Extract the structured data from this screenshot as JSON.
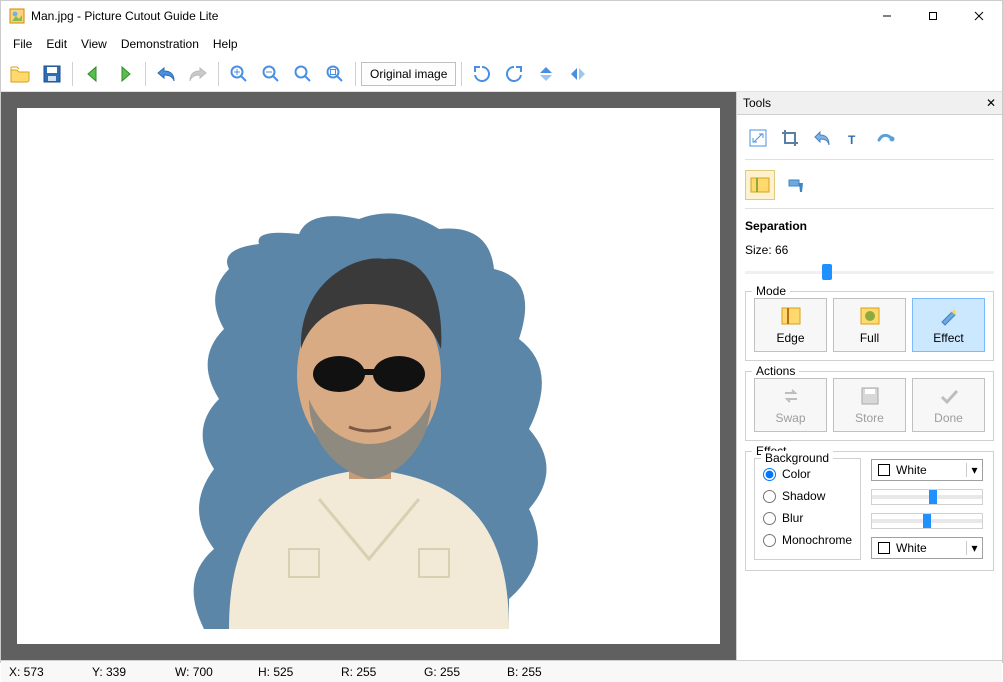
{
  "window": {
    "title": "Man.jpg - Picture Cutout Guide Lite"
  },
  "menu": {
    "file": "File",
    "edit": "Edit",
    "view": "View",
    "demo": "Demonstration",
    "help": "Help"
  },
  "toolbar": {
    "original_image": "Original image"
  },
  "tools": {
    "header": "Tools",
    "section": "Separation",
    "size_label": "Size: 66",
    "size_value": 66,
    "size_slider_percent": 33
  },
  "mode": {
    "legend": "Mode",
    "edge": "Edge",
    "full": "Full",
    "effect": "Effect",
    "selected": "effect"
  },
  "actions": {
    "legend": "Actions",
    "swap": "Swap",
    "store": "Store",
    "done": "Done"
  },
  "effect": {
    "legend": "Effect",
    "bg_legend": "Background",
    "color": "Color",
    "shadow": "Shadow",
    "blur": "Blur",
    "monochrome": "Monochrome",
    "selected": "color",
    "color_select": "White",
    "mono_select": "White",
    "shadow_slider": 55,
    "blur_slider": 50
  },
  "status": {
    "x": "X: 573",
    "y": "Y: 339",
    "w": "W: 700",
    "h": "H: 525",
    "r": "R: 255",
    "g": "G: 255",
    "b": "B: 255"
  }
}
